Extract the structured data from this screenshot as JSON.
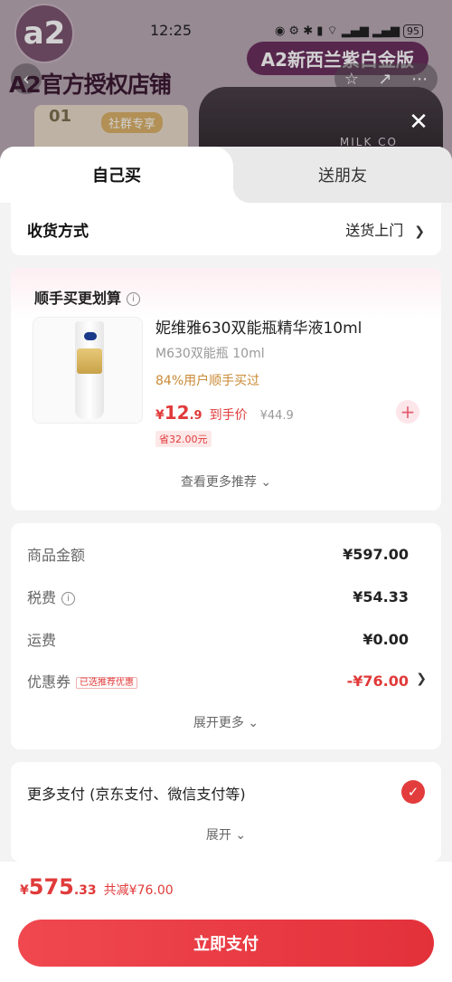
{
  "status_bar": {
    "time": "12:25",
    "battery": "95"
  },
  "store": {
    "name": "A2官方授权店铺",
    "banner": "A2新西兰紫白金版",
    "logo_text": "a2",
    "card_num": "01",
    "card_tag": "社群专享",
    "tin_label": "MILK CO"
  },
  "tabs": [
    {
      "label": "自己买"
    },
    {
      "label": "送朋友"
    }
  ],
  "delivery": {
    "label": "收货方式",
    "value": "送货上门"
  },
  "addon": {
    "title": "顺手买更划算",
    "product": {
      "title": "妮维雅630双能瓶精华液10ml",
      "spec": "M630双能瓶 10ml",
      "rate": "84%用户顺手买过",
      "price_int": "12",
      "price_dec": ".9",
      "price_label": "到手价",
      "original": "¥44.9",
      "save": "省32.00元"
    },
    "more": "查看更多推荐"
  },
  "summary": {
    "rows": [
      {
        "key": "商品金额",
        "value": "¥597.00"
      },
      {
        "key": "税费",
        "value": "¥54.33"
      },
      {
        "key": "运费",
        "value": "¥0.00"
      },
      {
        "key": "优惠券",
        "tag": "已选推荐优惠",
        "value": "-¥76.00"
      }
    ],
    "expand": "展开更多"
  },
  "payment": {
    "label": "更多支付 (京东支付、微信支付等)",
    "expand": "展开"
  },
  "footer": {
    "currency": "¥",
    "total_int": "575",
    "total_dec": ".33",
    "discount": "共减¥76.00",
    "pay_button": "立即支付"
  },
  "colors": {
    "accent": "#e13a3a",
    "pay_button": "#e8383f"
  }
}
